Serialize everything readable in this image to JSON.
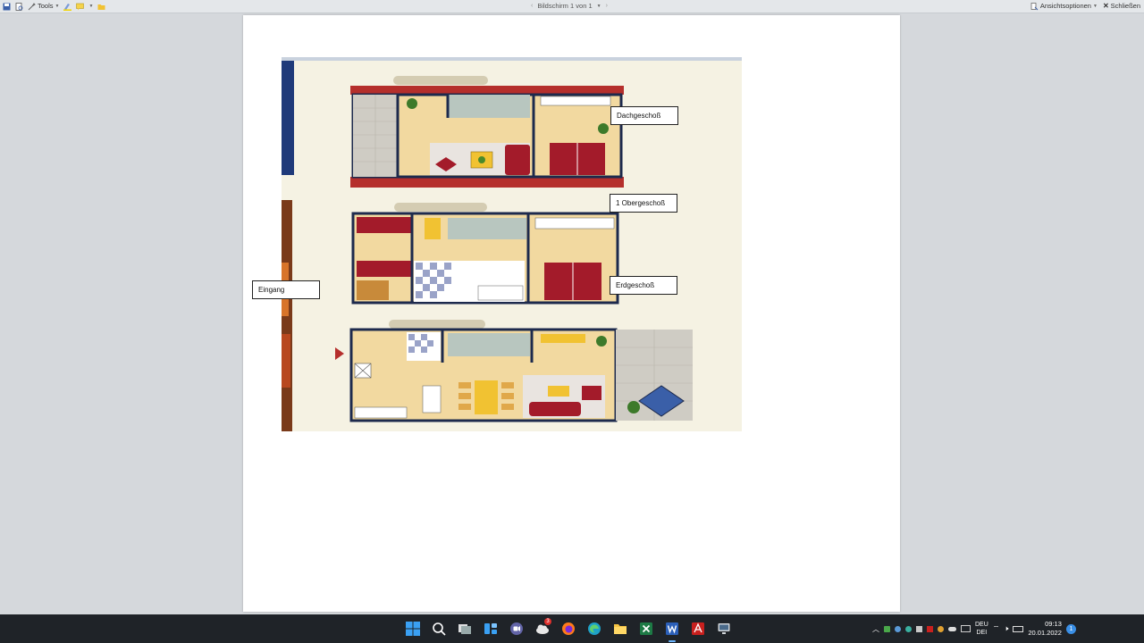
{
  "toolbar": {
    "tools_label": "Tools",
    "screen_label": "Bildschirm 1 von 1",
    "view_options_label": "Ansichtsoptionen",
    "close_label": "Schließen"
  },
  "page": {
    "labels": {
      "dachgeschoss": "Dachgeschoß",
      "obergeschoss": "1 Obergeschoß",
      "erdgeschoss": "Erdgeschoß",
      "eingang": "Eingang"
    }
  },
  "taskbar": {
    "chat_badge": "3",
    "lang_line1": "DEU",
    "lang_line2": "DEI",
    "time": "09:13",
    "date": "20.01.2022",
    "notification_count": "1",
    "active_app": "word"
  },
  "colors": {
    "roof": "#b52f2c",
    "floor": "#f2d9a0",
    "wall": "#1d2a4d",
    "furniture": "#a31b2a",
    "paper": "#f5f2e3"
  }
}
